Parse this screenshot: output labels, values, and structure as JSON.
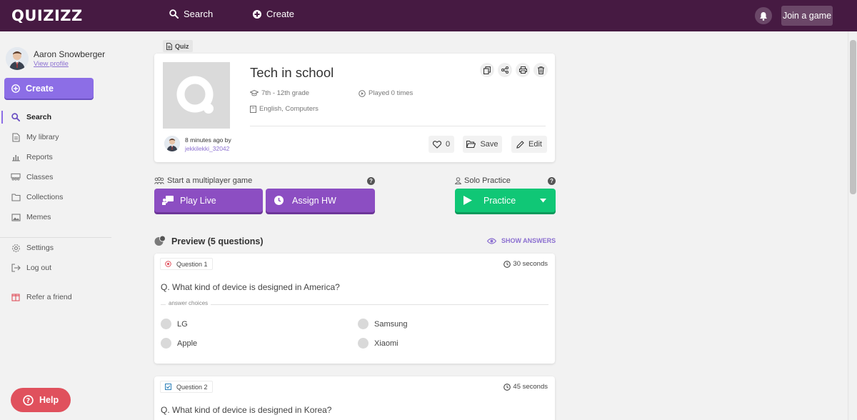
{
  "topbar": {
    "logo": "QUIZIZZ",
    "search_label": "Search",
    "create_label": "Create",
    "join_label": "Join a game"
  },
  "sidebar": {
    "user_name": "Aaron Snowberger",
    "view_profile": "View profile",
    "create_label": "Create",
    "items": [
      {
        "label": "Search",
        "icon": "search-icon",
        "active": true
      },
      {
        "label": "My library",
        "icon": "library-icon"
      },
      {
        "label": "Reports",
        "icon": "reports-icon"
      },
      {
        "label": "Classes",
        "icon": "classes-icon"
      },
      {
        "label": "Collections",
        "icon": "folder-icon"
      },
      {
        "label": "Memes",
        "icon": "image-icon"
      },
      {
        "label": "Settings",
        "icon": "gear-icon"
      },
      {
        "label": "Log out",
        "icon": "logout-icon"
      },
      {
        "label": "Refer a friend",
        "icon": "gift-icon"
      }
    ],
    "help_label": "Help"
  },
  "quiz": {
    "tag": "Quiz",
    "title": "Tech in school",
    "grade": "7th - 12th grade",
    "played": "Played 0 times",
    "subjects": "English, Computers",
    "ago": "8 minutes ago by",
    "author": "jekkilekki_32042",
    "likes": "0",
    "save_label": "Save",
    "edit_label": "Edit"
  },
  "actions": {
    "multiplayer_label": "Start a multiplayer game",
    "solo_label": "Solo Practice",
    "play_live": "Play Live",
    "assign_hw": "Assign HW",
    "practice": "Practice"
  },
  "preview": {
    "title": "Preview (5 questions)",
    "show_answers": "SHOW ANSWERS",
    "answer_choices_label": "answer choices",
    "questions": [
      {
        "label": "Question 1",
        "time": "30 seconds",
        "text": "Q. What kind of device is designed in America?",
        "choices": [
          "LG",
          "Samsung",
          "Apple",
          "Xiaomi"
        ]
      },
      {
        "label": "Question 2",
        "time": "45 seconds",
        "text": "Q. What kind of device is designed in Korea?"
      }
    ]
  },
  "colors": {
    "topbar": "#461a42",
    "accent_purple": "#8c6ee6",
    "button_purple": "#8c4ec2",
    "practice_green": "#10c776",
    "help_red": "#e0515d"
  }
}
